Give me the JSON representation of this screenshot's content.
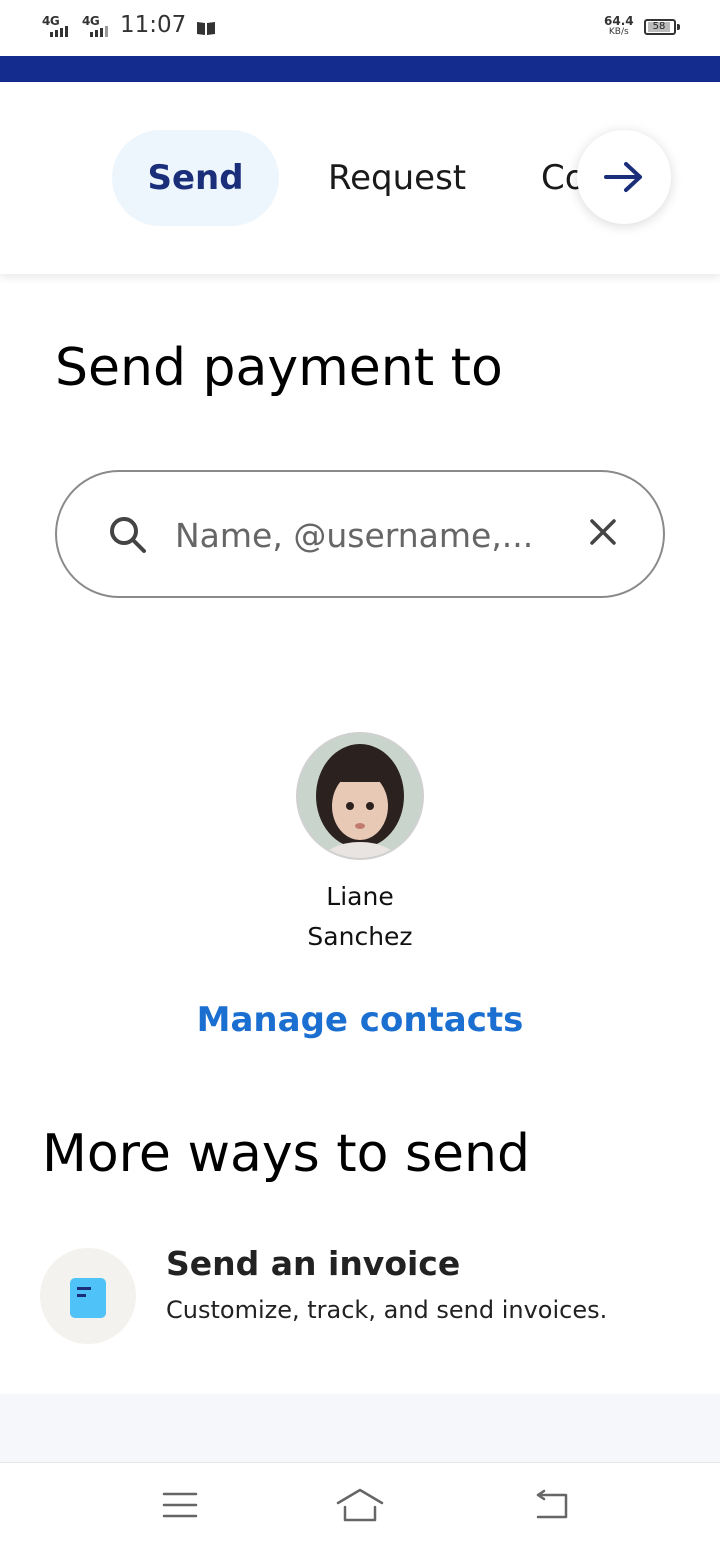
{
  "status_bar": {
    "sim1": "4G",
    "sim2": "4G",
    "time": "11:07",
    "net_speed_value": "64.4",
    "net_speed_unit": "KB/s",
    "battery": "58"
  },
  "tabs": [
    {
      "label": "Send",
      "active": true
    },
    {
      "label": "Request",
      "active": false
    },
    {
      "label": "Co",
      "active": false
    }
  ],
  "page": {
    "title": "Send payment to"
  },
  "search": {
    "placeholder": "Name, @username,..."
  },
  "contacts": [
    {
      "first_name": "Liane",
      "last_name": "Sanchez"
    }
  ],
  "manage_contacts_label": "Manage contacts",
  "more_ways": {
    "title": "More ways to send",
    "items": [
      {
        "title": "Send an invoice",
        "subtitle": "Customize, track, and send invoices.",
        "icon": "invoice-icon"
      }
    ]
  },
  "colors": {
    "brand_bar": "#142c8e",
    "active_tab_bg": "#eef6fd",
    "active_tab_text": "#1a2e7a",
    "link": "#1b6fd0",
    "invoice_icon": "#4fc3f7"
  },
  "nav_bar": {
    "buttons": [
      "menu-icon",
      "home-icon",
      "back-icon"
    ]
  }
}
